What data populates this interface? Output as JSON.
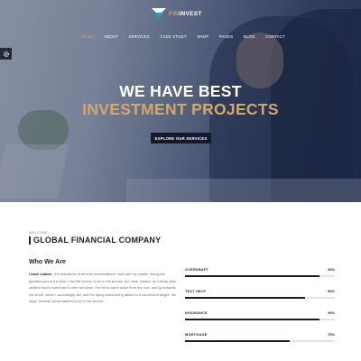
{
  "brand": {
    "name_prefix": "FIN",
    "name_suffix": "INVEST"
  },
  "nav": {
    "items": [
      {
        "label": "HOME",
        "active": true
      },
      {
        "label": "ABOUT"
      },
      {
        "label": "SERVICES"
      },
      {
        "label": "CASE STUDY"
      },
      {
        "label": "SHOP"
      },
      {
        "label": "PAGES"
      },
      {
        "label": "BLOG"
      },
      {
        "label": "CONTACT"
      }
    ]
  },
  "hero": {
    "title_line1": "WE HAVE BEST",
    "title_line2": "INVESTMENT PROJECTS",
    "button_label": "EXPLORE OUR SERVICES"
  },
  "about": {
    "kicker": "WELCOME",
    "title": "GLOBAL FINANCIAL COMPANY",
    "subtitle": "Who We Are",
    "lead": "I have related",
    "body": " - the substance of several conversations I had with my master during the greatest part of the time I had the honour to be in his service: but have, indeed, for brevity sake, omitted much more than is here set down. For he to come down from the rock, and go towards the shore, which I accordingly did; and the flying island being raised to a convenient height, the edge. Several conversations to be in his service."
  },
  "skills": [
    {
      "label": "OVERDRAFT",
      "percent_label": "90%",
      "value": 0.9
    },
    {
      "label": "TEXT HELP",
      "percent_label": "80%",
      "value": 0.8
    },
    {
      "label": "INSURANCE",
      "percent_label": "90%",
      "value": 0.9
    },
    {
      "label": "MORTGAGE",
      "percent_label": "70%",
      "value": 0.7
    }
  ],
  "colors": {
    "accent_gold": "#d6a867",
    "dark_navy": "#151a2b",
    "logo_blue": "#19a1d6"
  },
  "icons": {
    "settings_tab": "gear-icon",
    "logo": "logo-mark-icon"
  }
}
